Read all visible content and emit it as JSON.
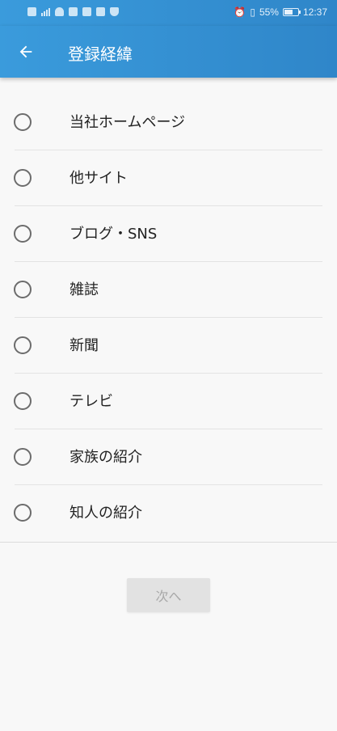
{
  "status_bar": {
    "battery": "55%",
    "time": "12:37"
  },
  "app_bar": {
    "title": "登録経緯",
    "back_icon": "arrow-left-icon"
  },
  "options": [
    "当社ホームページ",
    "他サイト",
    "ブログ・SNS",
    "雑誌",
    "新聞",
    "テレビ",
    "家族の紹介",
    "知人の紹介"
  ],
  "next_button": {
    "label": "次へ",
    "enabled": false
  },
  "colors": {
    "primary": "#2f86c9",
    "background": "#f8f8f8",
    "radio_border": "#6c6c6c",
    "button_disabled_bg": "#e2e2e2",
    "button_disabled_text": "#a8a8a8"
  }
}
